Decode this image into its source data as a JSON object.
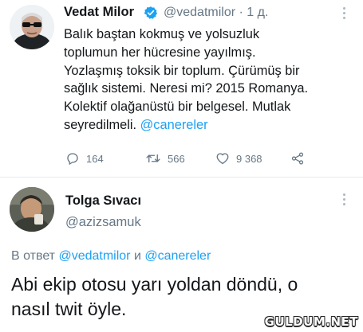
{
  "tweet1": {
    "display_name": "Vedat Milor",
    "handle": "@vedatmilor",
    "separator": "·",
    "time": "1 д.",
    "verified_icon": "verified-badge-icon",
    "lines": [
      "Balık baştan kokmuş ve yolsuzluk",
      "toplumun her hücresine yayılmış.",
      "Yozlaşmış toksik bir toplum. Çürümüş bir",
      "sağlık sistemi. Neresi mi? 2015 Romanya.",
      "Kolektif olağanüstü bir belgesel. Mutlak",
      "seyredilmeli. "
    ],
    "mention": "@canereler",
    "actions": {
      "reply_count": "164",
      "retweet_count": "566",
      "like_count": "9 368"
    }
  },
  "tweet2": {
    "display_name": "Tolga Sıvacı",
    "handle": "@azizsamuk",
    "reply_prefix": "В ответ ",
    "reply_mention1": "@vedatmilor",
    "reply_joiner": " и ",
    "reply_mention2": "@canereler",
    "text_line1": "Abi ekip otosu yarı yoldan döndü, o",
    "text_line2": "nasıl twit öyle."
  },
  "watermark": "GULDUM.NET",
  "colors": {
    "link": "#1da1f2",
    "secondary_text": "#657786",
    "primary_text": "#14171a",
    "divider": "#e6ecf0"
  }
}
